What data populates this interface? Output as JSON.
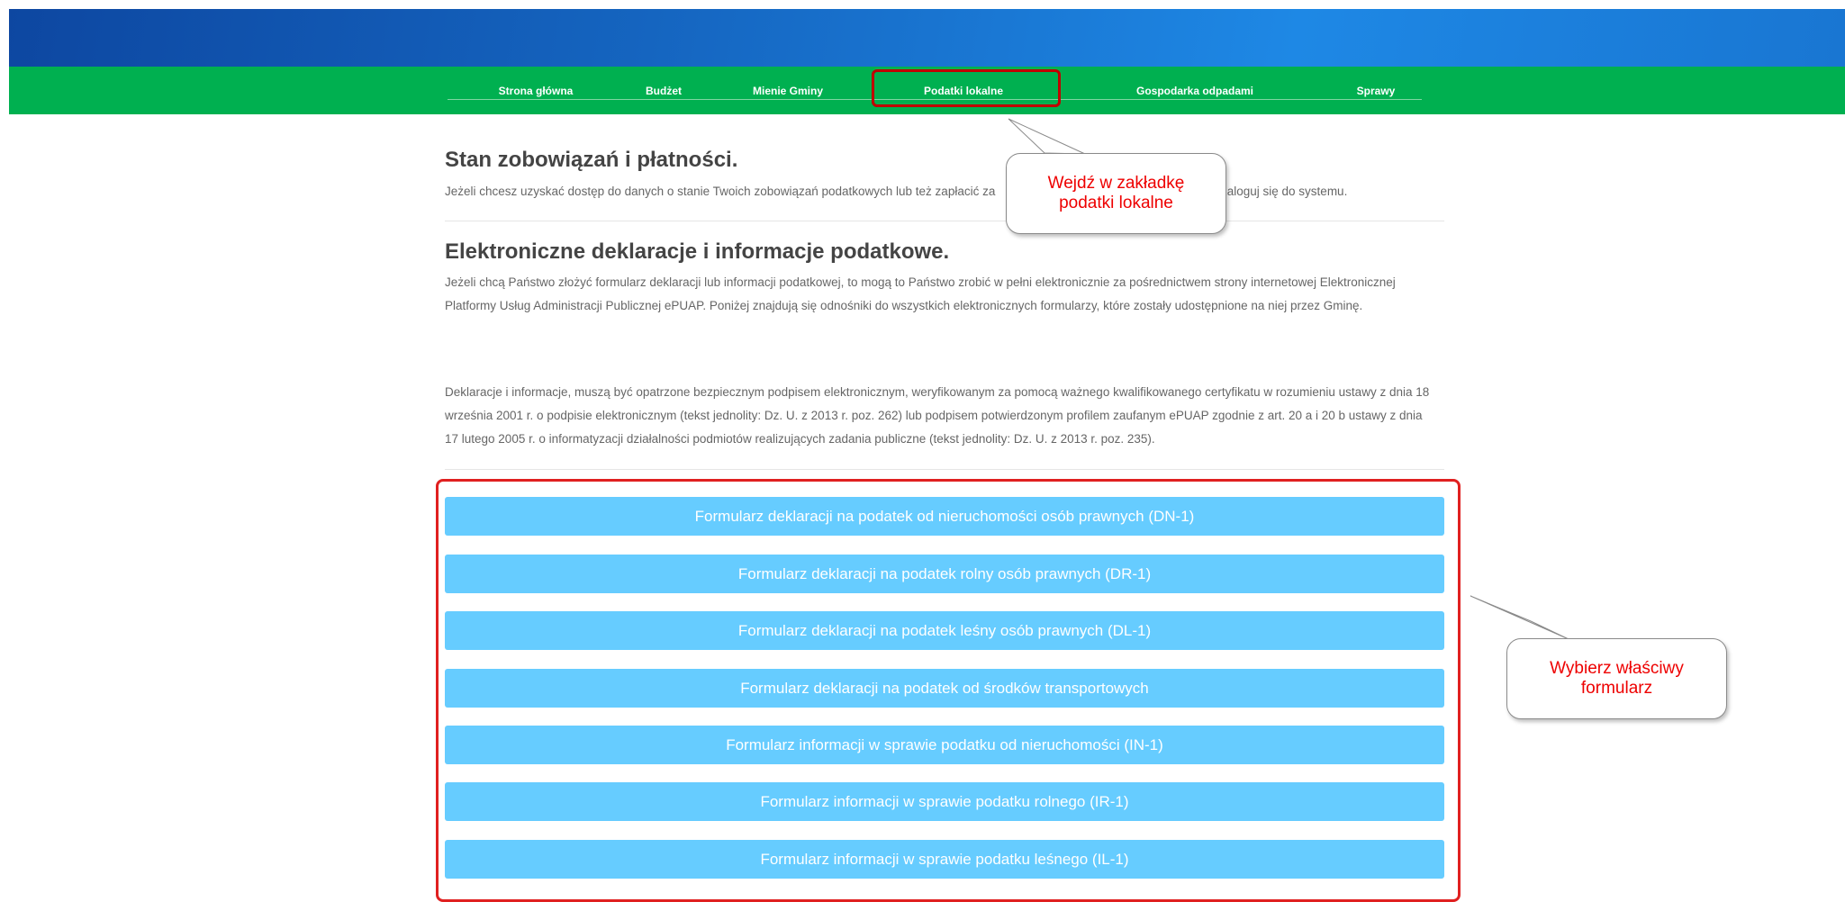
{
  "nav": {
    "items": [
      {
        "label": "Strona główna"
      },
      {
        "label": "Budżet"
      },
      {
        "label": "Mienie Gminy"
      },
      {
        "label": "Podatki lokalne"
      },
      {
        "label": "Gospodarka odpadami"
      },
      {
        "label": "Sprawy"
      }
    ]
  },
  "section1": {
    "title": "Stan zobowiązań i płatności.",
    "text": "Jeżeli chcesz uzyskać dostęp do danych o stanie Twoich zobowiązań podatkowych lub też zapłacić za",
    "text_tail": "zaloguj się do systemu."
  },
  "section2": {
    "title": "Elektroniczne deklaracje i informacje podatkowe.",
    "text": "Jeżeli chcą Państwo złożyć formularz deklaracji lub informacji podatkowej, to mogą to Państwo zrobić w pełni elektronicznie za pośrednictwem strony internetowej Elektronicznej Platformy Usług Administracji Publicznej ePUAP. Poniżej znajdują się odnośniki do wszystkich elektronicznych formularzy, które zostały udostępnione na niej przez Gminę.",
    "signature_note": "Deklaracje i informacje, muszą być opatrzone bezpiecznym podpisem elektronicznym, weryfikowanym za pomocą ważnego kwalifikowanego certyfikatu w rozumieniu ustawy z dnia 18 września 2001 r. o podpisie elektronicznym (tekst jednolity: Dz. U. z 2013 r. poz. 262) lub podpisem potwierdzonym profilem zaufanym ePUAP zgodnie z art. 20 a i 20 b ustawy z dnia 17 lutego 2005 r. o informatyzacji działalności podmiotów realizujących zadania publiczne (tekst jednolity: Dz. U. z 2013 r. poz. 235)."
  },
  "forms": [
    {
      "label": "Formularz deklaracji na podatek od nieruchomości osób prawnych (DN-1)"
    },
    {
      "label": "Formularz deklaracji na podatek rolny osób prawnych (DR-1)"
    },
    {
      "label": "Formularz deklaracji na podatek leśny osób prawnych (DL-1)"
    },
    {
      "label": "Formularz deklaracji na podatek od środków transportowych"
    },
    {
      "label": "Formularz informacji w sprawie podatku od nieruchomości (IN-1)"
    },
    {
      "label": "Formularz informacji w sprawie podatku rolnego (IR-1)"
    },
    {
      "label": "Formularz informacji w sprawie podatku leśnego (IL-1)"
    }
  ],
  "callouts": {
    "tab": {
      "line1": "Wejdź w zakładkę",
      "line2": "podatki lokalne"
    },
    "form": {
      "line1": "Wybierz właściwy",
      "line2": "formularz"
    }
  },
  "colors": {
    "header_blue": "#1565c0",
    "nav_green": "#00b050",
    "form_button": "#66ccff",
    "highlight_red": "#e02020",
    "callout_text": "#ee0000"
  }
}
